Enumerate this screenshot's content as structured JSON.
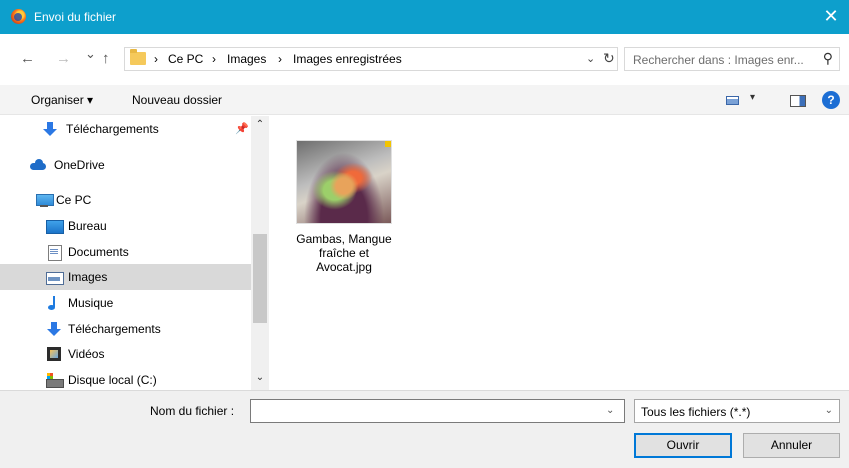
{
  "window": {
    "title": "Envoi du fichier",
    "close_glyph": "✕",
    "app_icon": "firefox-icon"
  },
  "nav": {
    "back_glyph": "←",
    "forward_glyph": "→",
    "recent_glyph": "⌄",
    "up_glyph": "↑",
    "separator": "›",
    "breadcrumb": [
      "Ce PC",
      "Images",
      "Images enregistrées"
    ],
    "address_dropdown_glyph": "⌄",
    "refresh_glyph": "↻",
    "search_placeholder": "Rechercher dans : Images enr...",
    "search_glyph": "⚲"
  },
  "toolbar": {
    "organize_label": "Organiser ▾",
    "new_folder_label": "Nouveau dossier",
    "view_dropdown_glyph": "▾",
    "help_glyph": "?"
  },
  "sidebar": {
    "pin_glyph": "📌",
    "items": [
      {
        "label": "Téléchargements",
        "icon": "download-icon"
      },
      {
        "label": "OneDrive",
        "icon": "onedrive-icon"
      },
      {
        "label": "Ce PC",
        "icon": "this-pc-icon"
      },
      {
        "label": "Bureau",
        "icon": "desktop-icon"
      },
      {
        "label": "Documents",
        "icon": "documents-icon"
      },
      {
        "label": "Images",
        "icon": "pictures-icon",
        "selected": true
      },
      {
        "label": "Musique",
        "icon": "music-icon"
      },
      {
        "label": "Téléchargements",
        "icon": "download-icon"
      },
      {
        "label": "Vidéos",
        "icon": "videos-icon"
      },
      {
        "label": "Disque local (C:)",
        "icon": "local-disk-icon"
      }
    ]
  },
  "scrollbar": {
    "up_glyph": "⌃",
    "down_glyph": "⌄"
  },
  "files": [
    {
      "name": "Gambas, Mangue fraîche et Avocat.jpg"
    }
  ],
  "footer": {
    "filename_label": "Nom du fichier :",
    "filename_value": "",
    "filename_dropdown_glyph": "⌄",
    "filter_value": "Tous les fichiers (*.*)",
    "filter_dropdown_glyph": "⌄",
    "open_label": "Ouvrir",
    "cancel_label": "Annuler"
  },
  "colors": {
    "titlebar": "#0d9fcc",
    "selection": "#d9d9d9",
    "primary_button_border": "#0078d7"
  }
}
